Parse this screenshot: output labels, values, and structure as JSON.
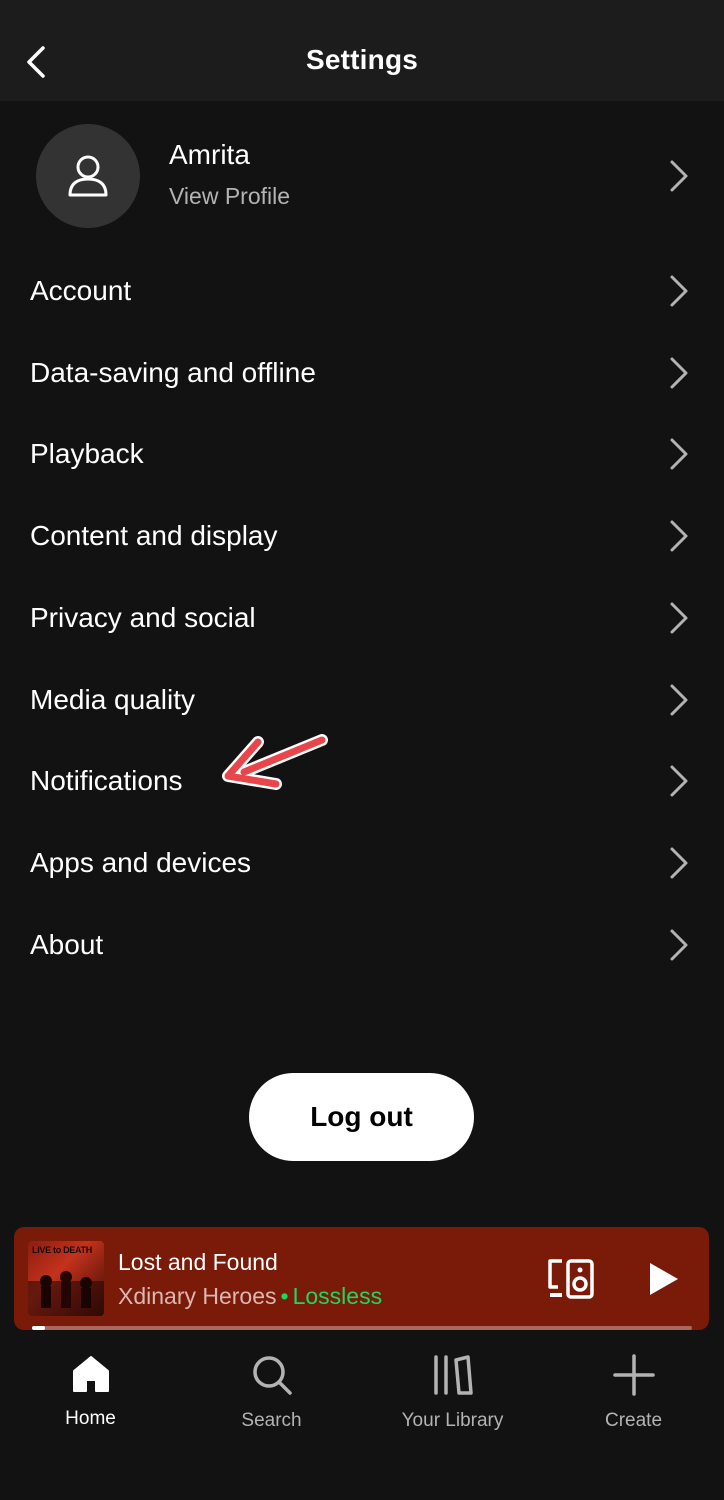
{
  "header": {
    "title": "Settings",
    "back_icon": "chevron-left-icon"
  },
  "profile": {
    "name": "Amrita",
    "subtitle": "View Profile",
    "avatar_icon": "user-icon"
  },
  "menu": {
    "items": [
      {
        "label": "Account"
      },
      {
        "label": "Data-saving and offline"
      },
      {
        "label": "Playback"
      },
      {
        "label": "Content and display"
      },
      {
        "label": "Privacy and social"
      },
      {
        "label": "Media quality"
      },
      {
        "label": "Notifications"
      },
      {
        "label": "Apps and devices"
      },
      {
        "label": "About"
      }
    ],
    "chevron_icon": "chevron-right-icon"
  },
  "annotation": {
    "icon": "annotation-arrow-icon",
    "color": "#e9464b"
  },
  "logout": {
    "label": "Log out"
  },
  "now_playing": {
    "title": "Lost and Found",
    "artist": "Xdinary Heroes",
    "separator": "•",
    "quality": "Lossless",
    "album_art_text": "LIVE to DEATH",
    "progress": 0.02,
    "background_color": "#7a1a09",
    "accent_color": "#1ed760"
  },
  "tabs": [
    {
      "label": "Home",
      "icon": "home-icon",
      "active": true
    },
    {
      "label": "Search",
      "icon": "search-icon",
      "active": false
    },
    {
      "label": "Your Library",
      "icon": "library-icon",
      "active": false
    },
    {
      "label": "Create",
      "icon": "plus-icon",
      "active": false
    }
  ]
}
